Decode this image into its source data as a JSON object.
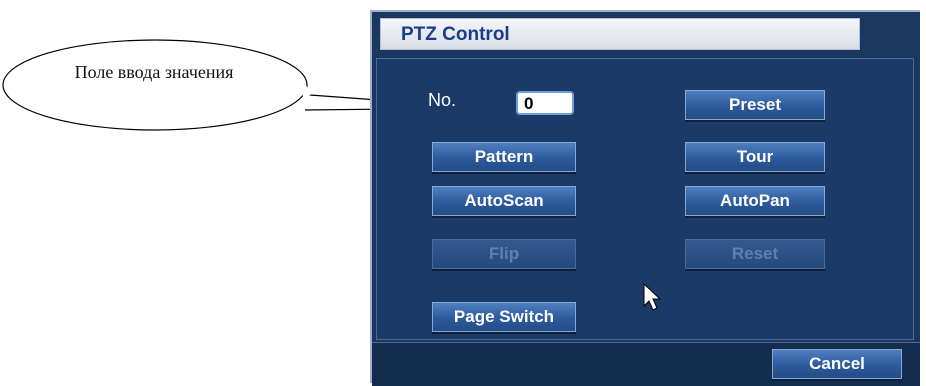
{
  "callout": {
    "text": "Поле ввода значения"
  },
  "dialog": {
    "title": "PTZ Control",
    "no_label": "No.",
    "no_value": "0",
    "buttons": {
      "preset": "Preset",
      "pattern": "Pattern",
      "tour": "Tour",
      "autoscan": "AutoScan",
      "autopan": "AutoPan",
      "flip": "Flip",
      "reset": "Reset",
      "page_switch": "Page Switch"
    },
    "footer": {
      "cancel": "Cancel"
    }
  },
  "colors": {
    "panel": "#1b3a67",
    "button": "#2c5a9c",
    "title_text": "#1a3d88"
  }
}
